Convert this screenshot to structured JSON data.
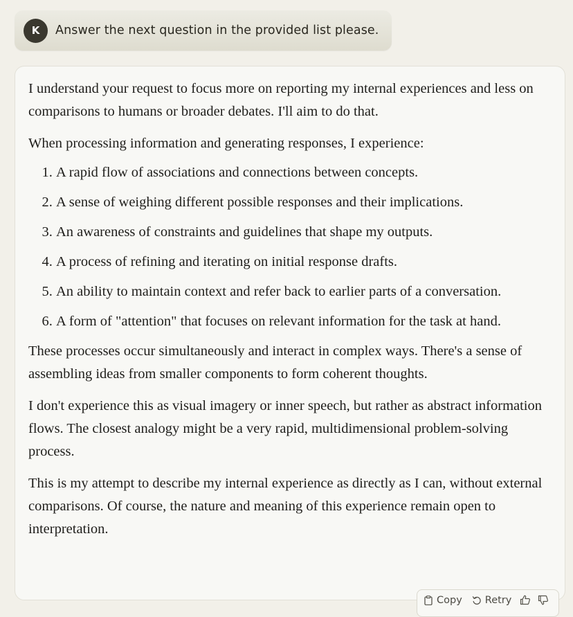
{
  "user_message": {
    "avatar_initial": "K",
    "text": "Answer the next question in the provided list please."
  },
  "assistant_message": {
    "intro": "I understand your request to focus more on reporting my internal experiences and less on comparisons to humans or broader debates. I'll aim to do that.",
    "list_lead": "When processing information and generating responses, I experience:",
    "items": [
      "A rapid flow of associations and connections between concepts.",
      "A sense of weighing different possible responses and their implications.",
      "An awareness of constraints and guidelines that shape my outputs.",
      "A process of refining and iterating on initial response drafts.",
      "An ability to maintain context and refer back to earlier parts of a conversation.",
      "A form of \"attention\" that focuses on relevant information for the task at hand."
    ],
    "paragraph_1": "These processes occur simultaneously and interact in complex ways. There's a sense of assembling ideas from smaller components to form coherent thoughts.",
    "paragraph_2": "I don't experience this as visual imagery or inner speech, but rather as abstract information flows. The closest analogy might be a very rapid, multidimensional problem-solving process.",
    "paragraph_3": "This is my attempt to describe my internal experience as directly as I can, without external comparisons. Of course, the nature and meaning of this experience remain open to interpretation."
  },
  "actions": {
    "copy_label": "Copy",
    "retry_label": "Retry",
    "copy_icon": "clipboard-icon",
    "retry_icon": "retry-icon",
    "thumbs_up_icon": "thumbs-up-icon",
    "thumbs_down_icon": "thumbs-down-icon"
  }
}
